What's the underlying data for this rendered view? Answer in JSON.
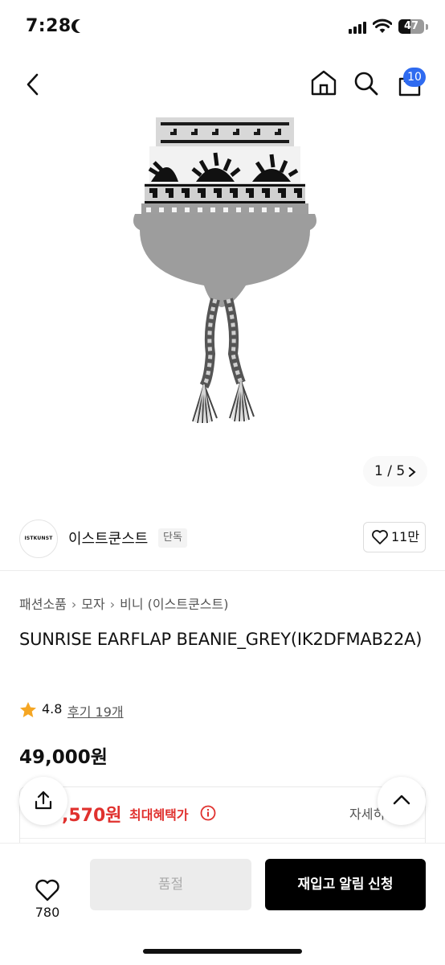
{
  "status_bar": {
    "time": "7:28",
    "battery": "47",
    "battery_level": 0.47
  },
  "header": {
    "cart_count": "10"
  },
  "gallery": {
    "pager": "1 / 5"
  },
  "brand": {
    "logo_text": "ISTKUNST",
    "name": "이스트쿤스트",
    "badge": "단독",
    "like_count": "11만"
  },
  "breadcrumb": [
    "패션소품",
    "모자",
    "비니 (이스트쿤스트)"
  ],
  "product": {
    "title": "SUNRISE EARFLAP BEANIE_GREY(IK2DFMAB22A)",
    "rating": "4.8",
    "review_link": "후기 19개",
    "price": "49,000원"
  },
  "benefit": {
    "price": ",570원",
    "label": "최대혜택가",
    "detail": "자세히"
  },
  "bottom_bar": {
    "like_count": "780",
    "soldout_label": "품절",
    "restock_label": "재입고 알림 신청"
  },
  "colors": {
    "accent_red": "#e0312e",
    "badge_blue": "#2f6bf0",
    "primary_button": "#000000"
  }
}
